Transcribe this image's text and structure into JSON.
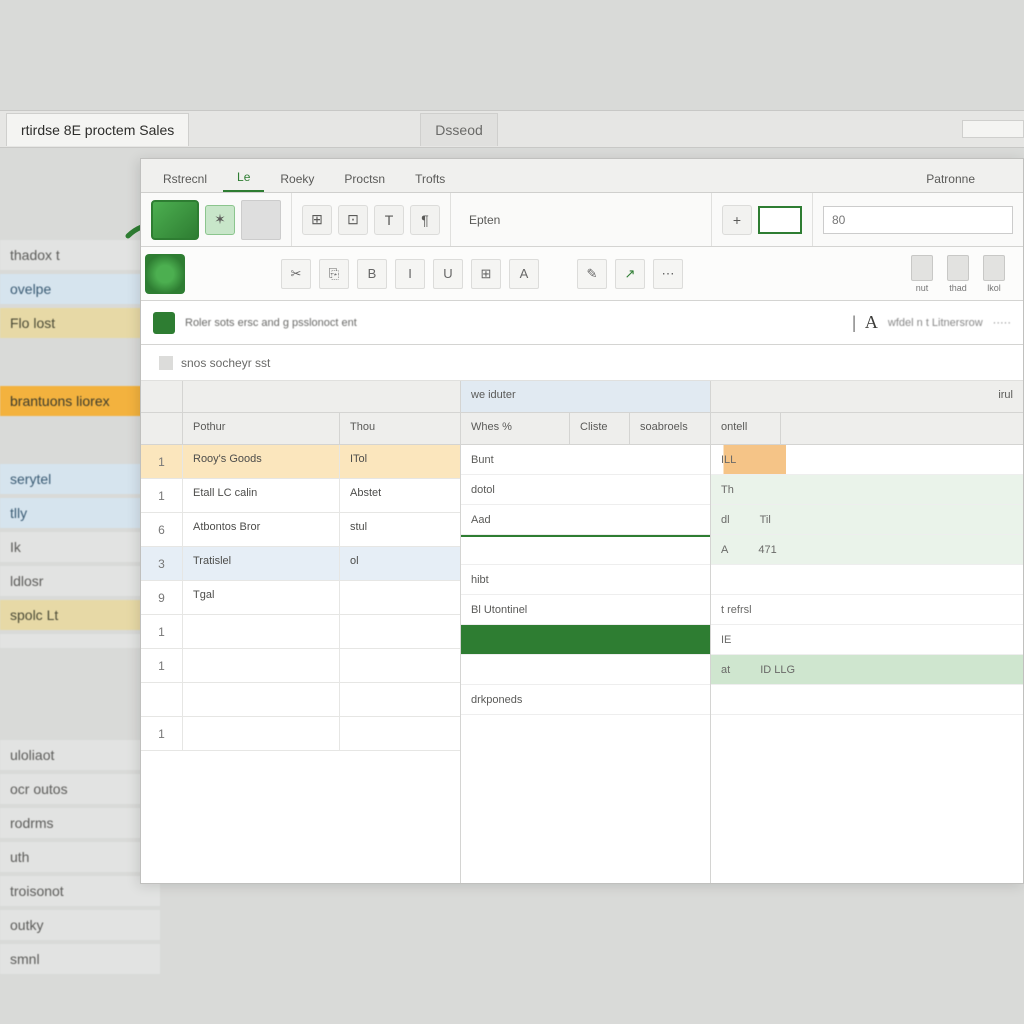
{
  "backdrop": {
    "tabs": [
      "rtirdse 8E proctem Sales",
      "Dsseod"
    ]
  },
  "sidebar": {
    "items": [
      {
        "label": "thadox t",
        "style": ""
      },
      {
        "label": "ovelpe",
        "style": "hl-blue"
      },
      {
        "label": "Flo lost",
        "style": "hl-yellow"
      },
      "gap",
      {
        "label": "brantuons liorex",
        "style": "hl-orange"
      },
      "gap",
      {
        "label": "serytel",
        "style": "hl-blue"
      },
      {
        "label": "tlly",
        "style": "hl-blue"
      },
      {
        "label": "Ik",
        "style": ""
      },
      {
        "label": "ldlosr",
        "style": ""
      },
      {
        "label": "spolc Lt",
        "style": "hl-yellow"
      },
      {
        "label": "",
        "style": ""
      },
      "gap",
      "gap",
      {
        "label": "uloliaot",
        "style": ""
      },
      {
        "label": "ocr outos",
        "style": ""
      },
      {
        "label": "rodrms",
        "style": ""
      },
      {
        "label": "uth",
        "style": ""
      },
      {
        "label": "troisonot",
        "style": ""
      },
      {
        "label": "outky",
        "style": ""
      },
      {
        "label": "smnl",
        "style": ""
      }
    ]
  },
  "ribbon": {
    "tabs": [
      "Rstrecnl",
      "Le",
      "Roeky",
      "Proctsn",
      "Trofts"
    ],
    "right_tab": "Patronne",
    "row1": {
      "label1": "Epten",
      "field_value": "80"
    },
    "row2_items": [
      "nut",
      "thad",
      "lkol"
    ],
    "info_text": "Roler sots  ersc  and  g  psslonoct  ent",
    "info_right": "wfdel n t Litnersrow",
    "subbar": "snos  socheyr  sst"
  },
  "grid": {
    "left": {
      "headers": [
        "Pothur",
        "Thou"
      ],
      "rows": [
        {
          "n": "1",
          "a": "Rooy's Goods",
          "b": "ITol",
          "sel": "o"
        },
        {
          "n": "1",
          "a": "Etall  LC calin",
          "b": "Abstet",
          "sel": ""
        },
        {
          "n": "6",
          "a": "Atbontos Bror",
          "b": "stul",
          "sel": ""
        },
        {
          "n": "3",
          "a": "Tratislel",
          "b": "ol",
          "sel": "b"
        },
        {
          "n": "9",
          "a": "Tgal",
          "b": "",
          "sel": ""
        },
        {
          "n": "1",
          "a": "",
          "b": "",
          "sel": ""
        },
        {
          "n": "1",
          "a": "",
          "b": "",
          "sel": ""
        },
        {
          "n": "",
          "a": "",
          "b": "",
          "sel": ""
        },
        {
          "n": "1",
          "a": "",
          "b": "",
          "sel": ""
        }
      ]
    },
    "mid": {
      "header_top": "we iduter",
      "headers": [
        "Whes %",
        "Cliste",
        "soabroels"
      ],
      "rows": [
        "Bunt",
        "dotol",
        "Aad",
        "",
        "hibt",
        "Bl Utontinel",
        "",
        "",
        "drkponeds"
      ]
    },
    "right": {
      "header_top": "irul",
      "header": "ontell",
      "rows": [
        [
          "ILL",
          ""
        ],
        [
          "Th",
          ""
        ],
        [
          "dl",
          "Til"
        ],
        [
          "A",
          "471"
        ],
        [
          "",
          ""
        ],
        [
          "t refrsl",
          ""
        ],
        [
          "IE",
          ""
        ],
        [
          "at",
          "ID LLG"
        ],
        [
          "",
          ""
        ]
      ]
    }
  }
}
